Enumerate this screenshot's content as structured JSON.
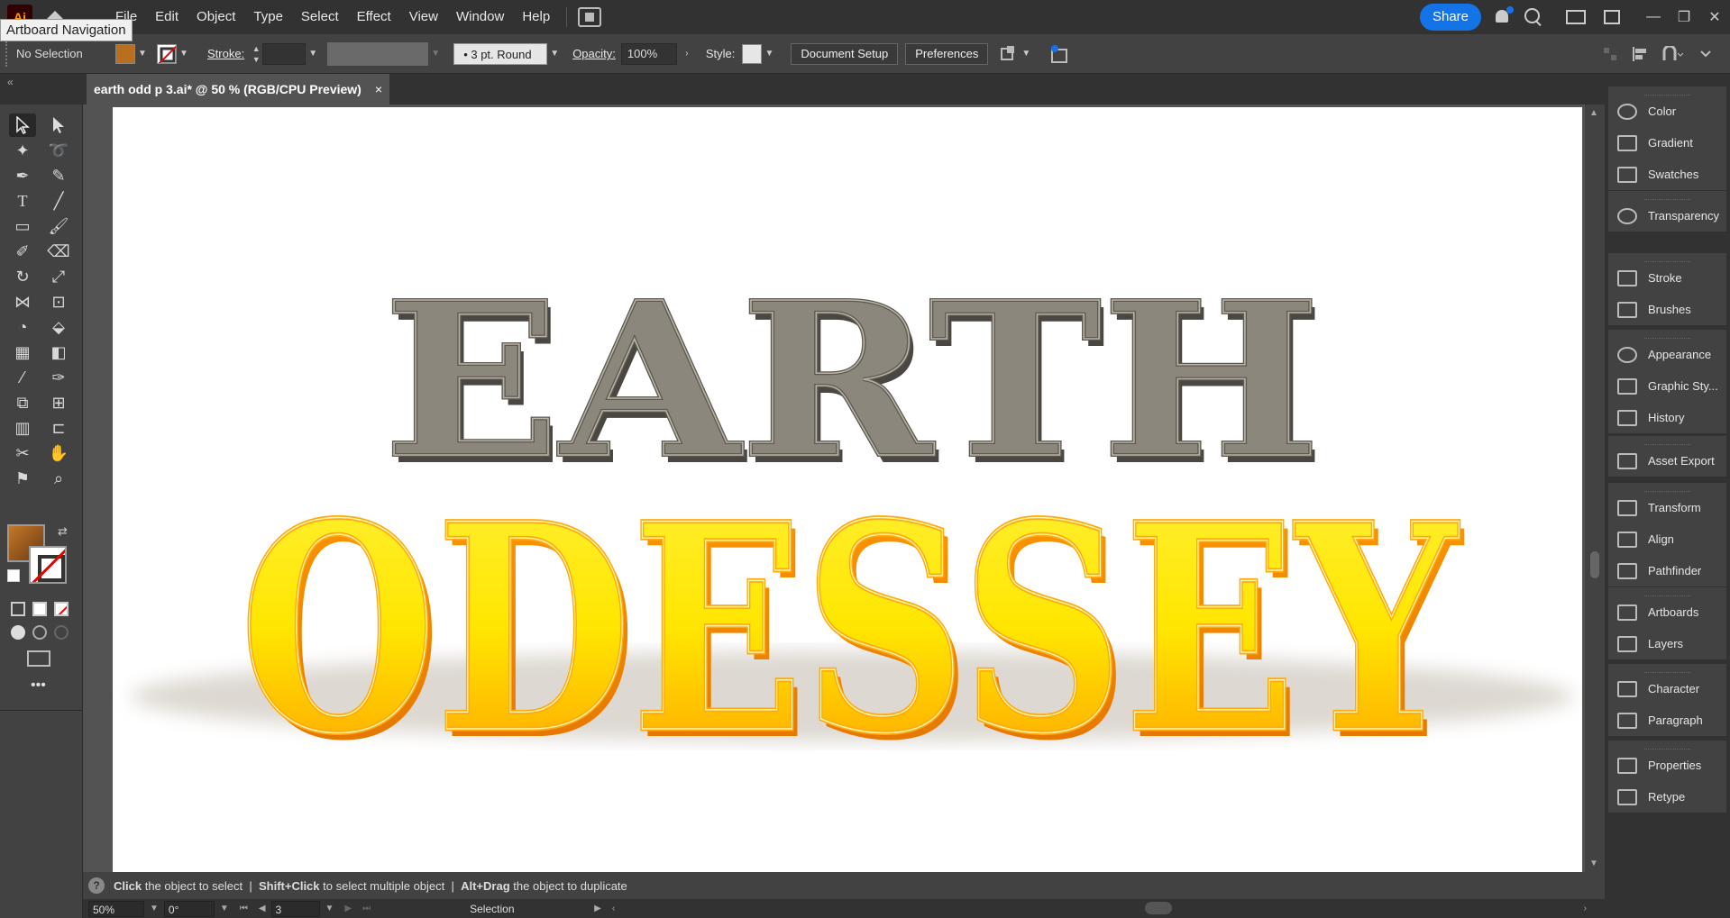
{
  "menubar": {
    "app_logo": "Ai",
    "items": [
      "File",
      "Edit",
      "Object",
      "Type",
      "Select",
      "Effect",
      "View",
      "Window",
      "Help"
    ],
    "tooltip": "Artboard Navigation",
    "share_label": "Share",
    "window_buttons": [
      "—",
      "❐",
      "✕"
    ]
  },
  "control": {
    "selection_label": "No Selection",
    "stroke_label": "Stroke:",
    "brush_label": "3 pt. Round",
    "opacity_label": "Opacity:",
    "opacity_value": "100%",
    "style_label": "Style:",
    "document_setup": "Document Setup",
    "preferences": "Preferences",
    "fill_color": "#b8701f"
  },
  "document": {
    "tab_title": "earth odd p 3.ai* @ 50 % (RGB/CPU Preview)",
    "close": "×"
  },
  "artwork": {
    "line1": "EARTH",
    "line2": "ODESSEY",
    "line1_color": "#8c877c",
    "line2_colors": [
      "#ffe600",
      "#ff9a00"
    ]
  },
  "panels": {
    "groups": [
      [
        "Color",
        "Gradient",
        "Swatches"
      ],
      [
        "Transparency"
      ],
      [
        "Stroke",
        "Brushes"
      ],
      [
        "Appearance",
        "Graphic Sty...",
        "History"
      ],
      [
        "Asset Export"
      ],
      [
        "Transform",
        "Align",
        "Pathfinder"
      ],
      [
        "Artboards",
        "Layers"
      ],
      [
        "Character",
        "Paragraph"
      ],
      [
        "Properties",
        "Retype"
      ]
    ]
  },
  "status": {
    "help_icon": "?",
    "hint_click": "Click",
    "hint_click_text": "the object to select",
    "hint_shift": "Shift+Click",
    "hint_shift_text": "to select multiple object",
    "hint_alt": "Alt+Drag",
    "hint_alt_text": "the object to duplicate",
    "separator": "|"
  },
  "bottombar": {
    "zoom": "50%",
    "rotation": "0°",
    "artboard_number": "3",
    "tool_name": "Selection"
  }
}
